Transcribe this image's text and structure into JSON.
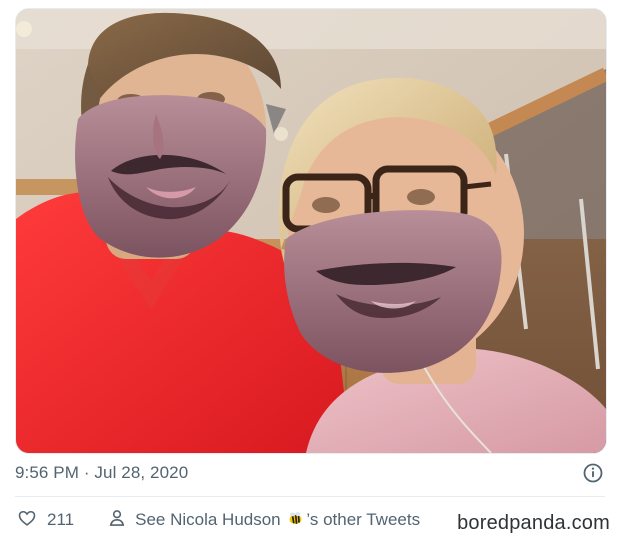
{
  "tweet": {
    "timestamp": "9:56 PM · Jul 28, 2020",
    "likes": "211",
    "see_tweets_prefix": "See Nicola Hudson",
    "see_tweets_suffix": "’s other Tweets",
    "bee_emoji": "bee-emoji"
  },
  "icons": {
    "info": "info-icon",
    "like": "heart-icon",
    "profile": "person-icon"
  },
  "colors": {
    "muted_text": "#536471",
    "divider": "#e6ecf0"
  },
  "watermark": {
    "text": "boredpanda.com"
  }
}
